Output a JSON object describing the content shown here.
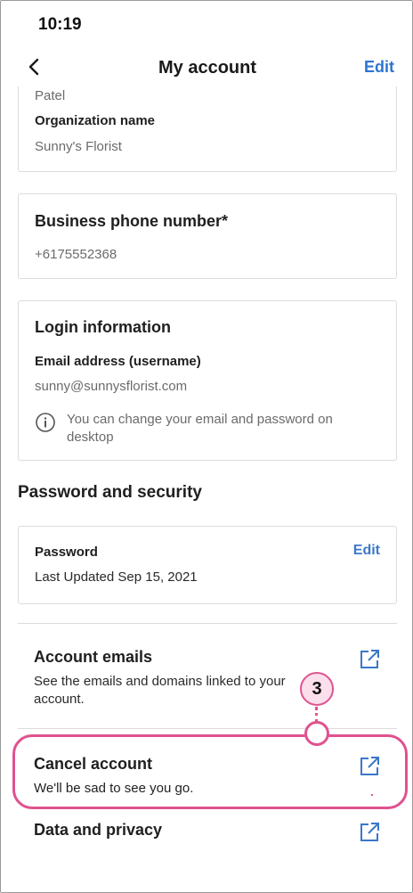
{
  "status_bar": {
    "time": "10:19"
  },
  "header": {
    "title": "My account",
    "edit_label": "Edit"
  },
  "profile_card": {
    "last_name_value": "Patel",
    "org_label": "Organization name",
    "org_value": "Sunny's Florist"
  },
  "phone_card": {
    "label": "Business phone number*",
    "value": "+6175552368"
  },
  "login_card": {
    "title": "Login information",
    "email_label": "Email address (username)",
    "email_value": "sunny@sunnysflorist.com",
    "info_text": "You can change your email and password on desktop"
  },
  "security": {
    "heading": "Password and security",
    "password_label": "Password",
    "password_updated": "Last Updated Sep 15, 2021",
    "edit_label": "Edit"
  },
  "links": [
    {
      "title": "Account emails",
      "description": "See the emails and domains linked to your account.",
      "icon": "external-link-icon"
    },
    {
      "title": "Cancel account",
      "description": "We'll be sad to see you go.",
      "icon": "external-link-icon"
    },
    {
      "title": "Data and privacy",
      "description": "",
      "icon": "external-link-icon"
    }
  ],
  "callout": {
    "number": "3",
    "color": "#e0528f"
  },
  "colors": {
    "accent": "#2f74d0",
    "highlight": "#e0528f"
  }
}
